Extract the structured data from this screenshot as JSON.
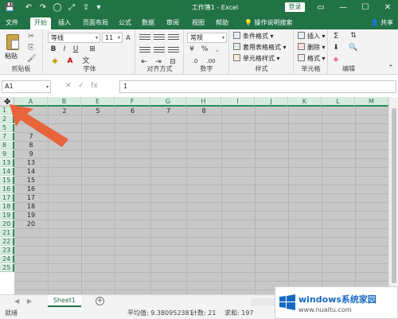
{
  "titlebar": {
    "title": "工作簿1 - Excel",
    "login": "登录",
    "quick_access": [
      "💾",
      "↶",
      "↷",
      "◯",
      "⤢",
      "⇪",
      "▾"
    ],
    "window_buttons": [
      "▭",
      "—",
      "☐",
      "✕"
    ]
  },
  "tabs": [
    "文件",
    "开始",
    "插入",
    "页面布局",
    "公式",
    "数据",
    "审阅",
    "视图",
    "帮助"
  ],
  "active_tab": "开始",
  "tell_me": "操作说明搜索",
  "share": "共享",
  "ribbon": {
    "clipboard": {
      "paste": "粘贴",
      "label": "剪贴板"
    },
    "font": {
      "name": "等线",
      "size": "11",
      "label": "字体",
      "bold": "B",
      "italic": "I",
      "underline": "U",
      "grow": "A",
      "shrink": "A"
    },
    "align": {
      "label": "对齐方式"
    },
    "number": {
      "format": "常规",
      "label": "数字",
      "percent": "%",
      "comma": ",",
      "currency": "¥"
    },
    "styles": {
      "cond": "条件格式",
      "table": "套用表格格式",
      "cell": "单元格样式",
      "label": "样式"
    },
    "cells": {
      "insert": "插入",
      "delete": "删除",
      "format": "格式",
      "label": "单元格"
    },
    "editing": {
      "sum": "Σ",
      "label": "编辑"
    }
  },
  "formula_bar": {
    "name_box": "A1",
    "value": "1",
    "fx": "fx"
  },
  "columns": [
    "A",
    "B",
    "E",
    "F",
    "G",
    "H",
    "I",
    "J",
    "K",
    "L",
    "M"
  ],
  "rows": [
    "1",
    "2",
    "5",
    "7",
    "8",
    "9",
    "13",
    "14",
    "15",
    "16",
    "17",
    "18",
    "19",
    "20",
    "21",
    "22",
    "23",
    "24",
    "25"
  ],
  "cells": {
    "r1": [
      "2",
      "5",
      "6",
      "7",
      "8"
    ],
    "colA": [
      "7",
      "8",
      "9",
      "13",
      "14",
      "15",
      "16",
      "17",
      "18",
      "19",
      "20"
    ]
  },
  "sheet": {
    "name": "Sheet1",
    "add": "+"
  },
  "status": {
    "ready": "就绪",
    "average": "平均值: 9.380952381",
    "count": "计数: 21",
    "sum": "求和: 197"
  },
  "watermark": {
    "brand": "windows系统家园",
    "url": "www.nuaitu.com"
  },
  "colors": {
    "accent": "#217346",
    "arrow": "#e8653c"
  }
}
